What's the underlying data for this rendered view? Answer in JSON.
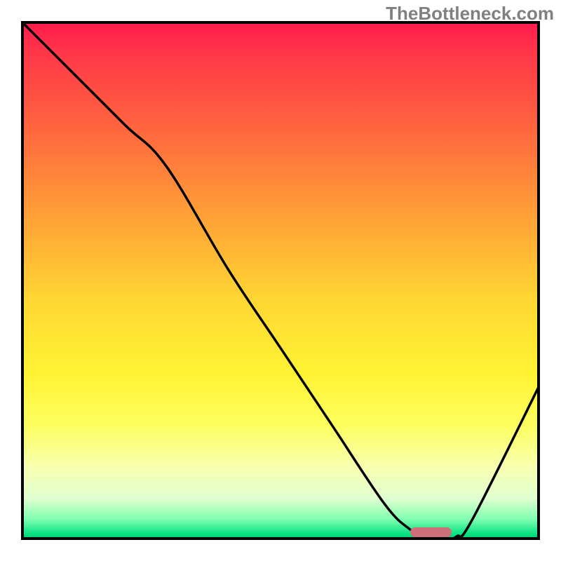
{
  "watermark": "TheBottleneck.com",
  "chart_data": {
    "type": "line",
    "title": "",
    "xlabel": "",
    "ylabel": "",
    "xlim": [
      0,
      100
    ],
    "ylim": [
      0,
      100
    ],
    "grid": false,
    "legend": false,
    "series": [
      {
        "name": "curve",
        "x": [
          0,
          10,
          20,
          28,
          40,
          50,
          60,
          70,
          75,
          78,
          82,
          84,
          87,
          100
        ],
        "values": [
          100,
          90,
          80,
          72,
          52,
          37,
          22,
          7,
          2,
          0.5,
          0.3,
          0.7,
          4,
          30
        ]
      }
    ],
    "marker": {
      "x_start": 75,
      "x_end": 83,
      "y": 1.5,
      "color": "#cc6f78"
    },
    "background_gradient": {
      "top": "#ff1a4d",
      "mid": "#ffe033",
      "bottom": "#00c070"
    }
  }
}
